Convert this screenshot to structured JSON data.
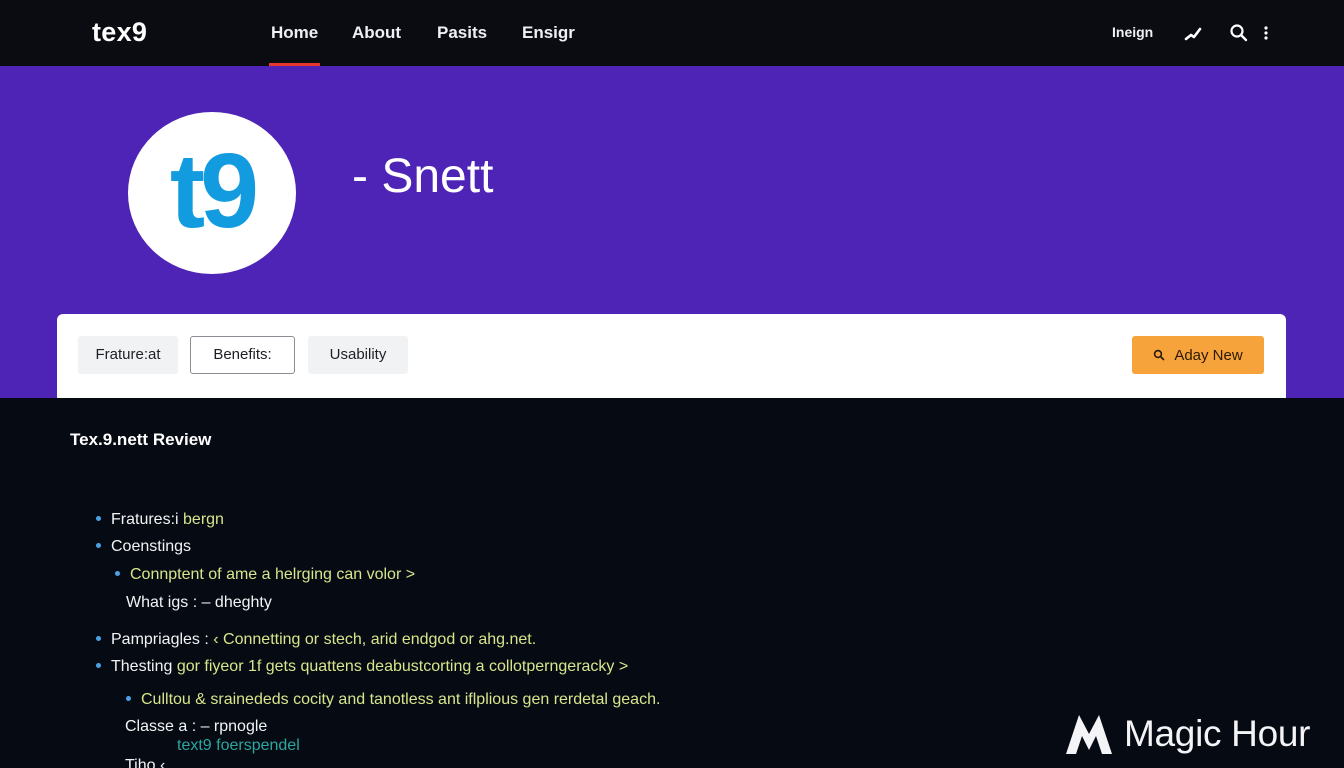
{
  "nav": {
    "brand": "tex9",
    "links": [
      {
        "label": "Home",
        "active": true
      },
      {
        "label": "About",
        "active": false
      },
      {
        "label": "Pasits",
        "active": false
      },
      {
        "label": "Ensigr",
        "active": false
      }
    ],
    "right_text": "Ineign",
    "icons": [
      "edit-icon",
      "search-icon",
      "more-vertical-icon"
    ],
    "active_color": "#e8352f"
  },
  "hero": {
    "logo_text": "t9",
    "title": "- Snett",
    "background": "#4d24b5",
    "logo_color": "#139be0"
  },
  "tabs": {
    "items": [
      "Frature:at",
      "Benefits:",
      "Usability"
    ],
    "selected": 1,
    "action_label": "Aday New",
    "action_icon": "search-icon",
    "action_color": "#f7a33c"
  },
  "content": {
    "title": "Tex.9.nett Review",
    "items": [
      {
        "lead": "Fratures:i",
        "rest": "bergn"
      },
      {
        "lead": "Coenstings",
        "rest": ""
      },
      {
        "lead": "",
        "rest": "Connptent of ame a helrging can volor >"
      },
      {
        "lead": "What igs : – dhegh​ty",
        "rest": ""
      },
      {
        "lead": "Pampriagles :",
        "rest": "‹  Connetting or stech, arid endgod or ahg.net."
      },
      {
        "lead": "Thesting",
        "rest": "gor fiyeor 1f gets quattens deabustcorting a collotperngeracky >"
      },
      {
        "lead": "",
        "rest": "Culltou & srainededs cocity and tanotless ant iflplious gen rerdetal geach."
      },
      {
        "lead": "Classe a : – rpnogle",
        "rest": ""
      },
      {
        "lead": "",
        "rest": "text9 foerspendel"
      },
      {
        "lead": "Tiho",
        "rest": "‹"
      }
    ]
  },
  "watermark": {
    "text": "Magic Hour",
    "icon": "magic-hour-logo-icon"
  }
}
